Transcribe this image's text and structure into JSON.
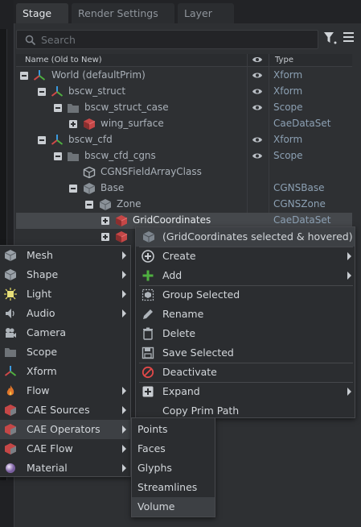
{
  "tabs": [
    "Stage",
    "Render Settings",
    "Layer"
  ],
  "search": {
    "placeholder": "Search"
  },
  "columns": {
    "name": "Name (Old to New)",
    "type": "Type"
  },
  "tree": [
    {
      "name": "World (defaultPrim)",
      "type": "Xform",
      "icon": "xform-icon",
      "visible": true
    },
    {
      "name": "bscw_struct",
      "type": "Xform",
      "icon": "xform-icon",
      "visible": true
    },
    {
      "name": "bscw_struct_case",
      "type": "Scope",
      "icon": "folder-icon",
      "visible": true
    },
    {
      "name": "wing_surface",
      "type": "CaeDataSet",
      "icon": "cae-dataset-icon",
      "visible": false
    },
    {
      "name": "bscw_cfd",
      "type": "Xform",
      "icon": "xform-icon",
      "visible": true
    },
    {
      "name": "bscw_cfd_cgns",
      "type": "Scope",
      "icon": "folder-icon",
      "visible": true
    },
    {
      "name": "CGNSFieldArrayClass",
      "type": "",
      "icon": "cube-outline-icon",
      "visible": false
    },
    {
      "name": "Base",
      "type": "CGNSBase",
      "icon": "cube-icon",
      "visible": false
    },
    {
      "name": "Zone",
      "type": "CGNSZone",
      "icon": "cube-icon",
      "visible": false
    },
    {
      "name": "GridCoordinates",
      "type": "CaeDataSet",
      "icon": "cae-dataset-icon",
      "visible": false
    }
  ],
  "context_menu": {
    "header": "(GridCoordinates selected & hovered)",
    "items": [
      {
        "label": "Create",
        "icon": "plus-circle-icon",
        "submenu": true
      },
      {
        "label": "Add",
        "icon": "plus-icon",
        "submenu": true
      },
      {
        "label": "Group Selected",
        "icon": "group-icon",
        "submenu": false
      },
      {
        "label": "Rename",
        "icon": "pencil-icon",
        "submenu": false
      },
      {
        "label": "Delete",
        "icon": "trash-icon",
        "submenu": false
      },
      {
        "label": "Save Selected",
        "icon": "save-icon",
        "submenu": false
      },
      {
        "label": "Deactivate",
        "icon": "deactivate-icon",
        "submenu": false
      },
      {
        "label": "Expand",
        "icon": "expand-icon",
        "submenu": true
      },
      {
        "label": "Copy Prim Path",
        "icon": "",
        "submenu": false
      }
    ]
  },
  "create_menu": [
    {
      "label": "Mesh",
      "icon": "mesh-icon",
      "submenu": true
    },
    {
      "label": "Shape",
      "icon": "shape-icon",
      "submenu": true
    },
    {
      "label": "Light",
      "icon": "light-icon",
      "submenu": true
    },
    {
      "label": "Audio",
      "icon": "audio-icon",
      "submenu": true
    },
    {
      "label": "Camera",
      "icon": "camera-icon",
      "submenu": false
    },
    {
      "label": "Scope",
      "icon": "folder-icon",
      "submenu": false
    },
    {
      "label": "Xform",
      "icon": "xform-icon",
      "submenu": false
    },
    {
      "label": "Flow",
      "icon": "flame-icon",
      "submenu": true
    },
    {
      "label": "CAE Sources",
      "icon": "cae-sources-icon",
      "submenu": true
    },
    {
      "label": "CAE Operators",
      "icon": "cae-operators-icon",
      "submenu": true
    },
    {
      "label": "CAE Flow",
      "icon": "cae-flow-icon",
      "submenu": true
    },
    {
      "label": "Material",
      "icon": "material-icon",
      "submenu": true
    }
  ],
  "cae_operators_menu": [
    "Points",
    "Faces",
    "Glyphs",
    "Streamlines",
    "Volume"
  ],
  "colors": {
    "accent_type": "#8ca0b3",
    "selected_row": "#45484c",
    "menu_bg": "#2b2d30"
  }
}
